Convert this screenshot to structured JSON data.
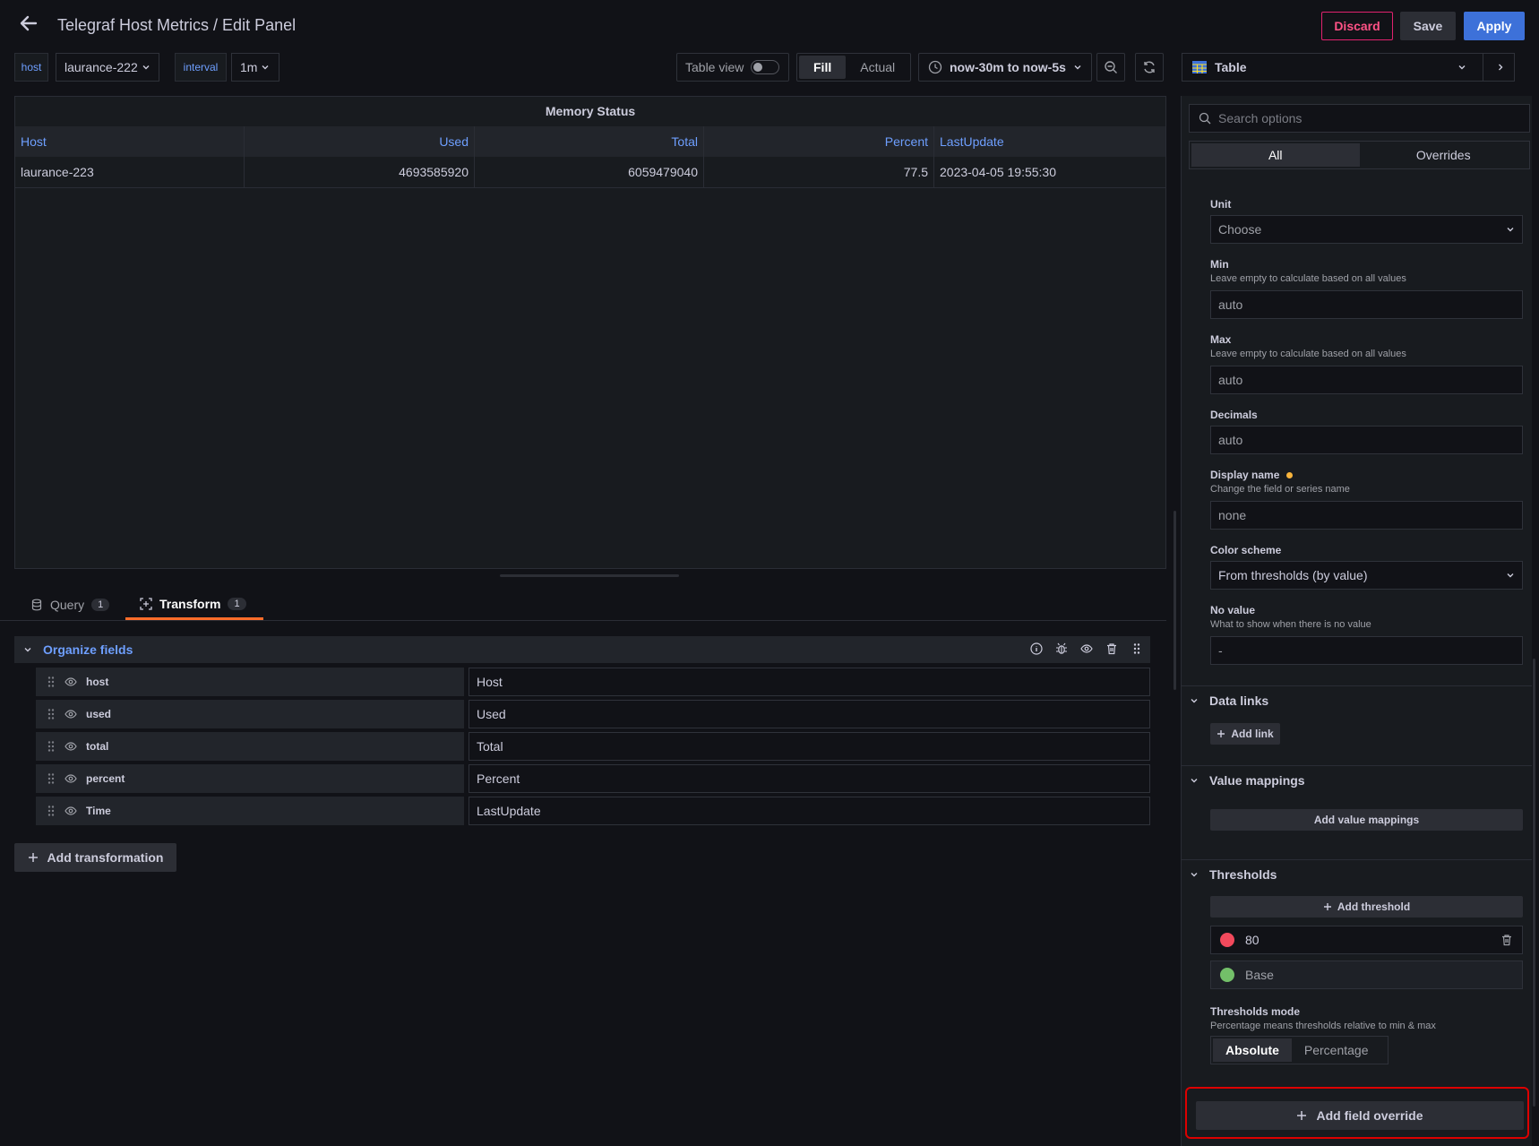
{
  "header": {
    "title": "Telegraf Host Metrics / Edit Panel",
    "discard": "Discard",
    "save": "Save",
    "apply": "Apply"
  },
  "variables": [
    {
      "label": "host",
      "value": "laurance-222"
    },
    {
      "label": "interval",
      "value": "1m"
    }
  ],
  "toolbar": {
    "table_view": "Table view",
    "fill": "Fill",
    "actual": "Actual",
    "time_range": "now-30m to now-5s"
  },
  "viz": {
    "name": "Table"
  },
  "panel": {
    "title": "Memory Status",
    "columns": [
      "Host",
      "Used",
      "Total",
      "Percent",
      "LastUpdate"
    ],
    "rows": [
      [
        "laurance-223",
        "4693585920",
        "6059479040",
        "77.5",
        "2023-04-05 19:55:30"
      ]
    ]
  },
  "tabs": {
    "query": "Query",
    "query_count": "1",
    "transform": "Transform",
    "transform_count": "1"
  },
  "organize": {
    "title": "Organize fields",
    "fields": [
      {
        "name": "host",
        "rename": "Host"
      },
      {
        "name": "used",
        "rename": "Used"
      },
      {
        "name": "total",
        "rename": "Total"
      },
      {
        "name": "percent",
        "rename": "Percent"
      },
      {
        "name": "Time",
        "rename": "LastUpdate"
      }
    ],
    "add_transformation": "Add transformation"
  },
  "options": {
    "search_placeholder": "Search options",
    "tab_all": "All",
    "tab_overrides": "Overrides",
    "unit_label": "Unit",
    "unit_value": "Choose",
    "min_label": "Min",
    "min_desc": "Leave empty to calculate based on all values",
    "min_value": "auto",
    "max_label": "Max",
    "max_desc": "Leave empty to calculate based on all values",
    "max_value": "auto",
    "decimals_label": "Decimals",
    "decimals_value": "auto",
    "display_name_label": "Display name",
    "display_name_desc": "Change the field or series name",
    "display_name_value": "none",
    "color_scheme_label": "Color scheme",
    "color_scheme_value": "From thresholds (by value)",
    "no_value_label": "No value",
    "no_value_desc": "What to show when there is no value",
    "no_value_value": "-",
    "data_links": "Data links",
    "add_link": "Add link",
    "value_mappings": "Value mappings",
    "add_value_mappings": "Add value mappings",
    "thresholds": "Thresholds",
    "add_threshold": "Add threshold",
    "threshold_red": "80",
    "threshold_base": "Base",
    "thresholds_mode_label": "Thresholds mode",
    "thresholds_mode_desc": "Percentage means thresholds relative to min & max",
    "mode_absolute": "Absolute",
    "mode_percentage": "Percentage",
    "add_field_override": "Add field override"
  },
  "colors": {
    "threshold_red": "#f2495c",
    "threshold_green": "#73bf69",
    "accent_blue": "#6e9fff",
    "transform_underline": "#ff6d2a"
  }
}
